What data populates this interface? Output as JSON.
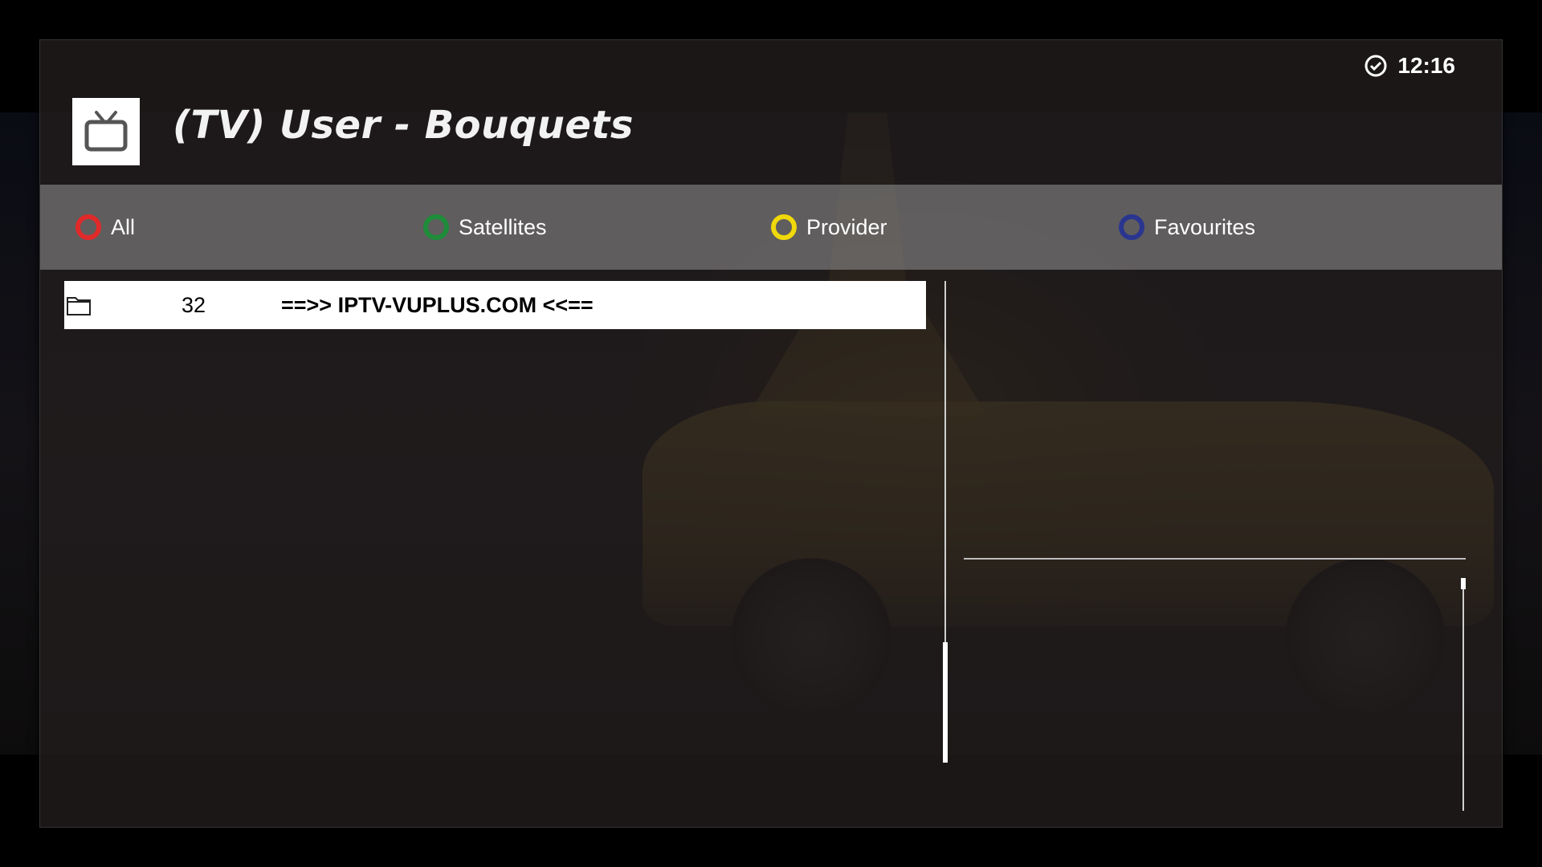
{
  "clock": {
    "time": "12:16",
    "icon": "clock-icon"
  },
  "header": {
    "title": "(TV) User - Bouquets",
    "icon": "tv-icon"
  },
  "color_buttons": [
    {
      "label": "All",
      "color": "#e02a2a"
    },
    {
      "label": "Satellites",
      "color": "#1e8c3a"
    },
    {
      "label": "Provider",
      "color": "#f0d80a"
    },
    {
      "label": "Favourites",
      "color": "#2a3590"
    }
  ],
  "list": {
    "items": [
      {
        "icon": "folder-icon",
        "number": "32",
        "name": "==>> IPTV-VUPLUS.COM <<==",
        "selected": true
      }
    ]
  }
}
